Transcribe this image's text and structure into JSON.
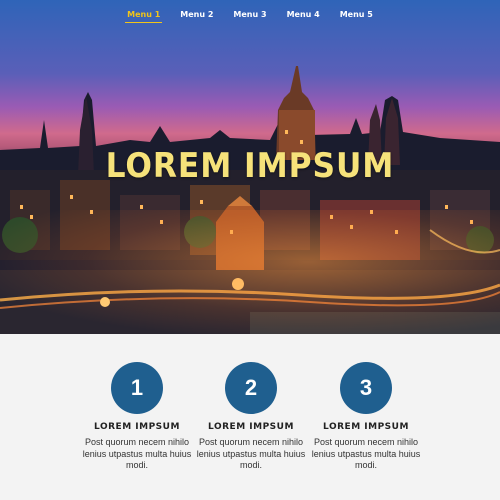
{
  "nav": {
    "items": [
      {
        "label": "Menu 1",
        "active": true
      },
      {
        "label": "Menu 2",
        "active": false
      },
      {
        "label": "Menu 3",
        "active": false
      },
      {
        "label": "Menu 4",
        "active": false
      },
      {
        "label": "Menu 5",
        "active": false
      }
    ]
  },
  "hero": {
    "title": "LOREM IMPSUM"
  },
  "features": [
    {
      "number": "1",
      "title": "LOREM IMPSUM",
      "text": "Post quorum necem nihilo lenius utpastus multa huius modi."
    },
    {
      "number": "2",
      "title": "LOREM IMPSUM",
      "text": "Post quorum necem nihilo lenius utpastus multa huius modi."
    },
    {
      "number": "3",
      "title": "LOREM IMPSUM",
      "text": "Post quorum necem nihilo lenius utpastus multa huius modi."
    }
  ],
  "colors": {
    "accent": "#f0c51a",
    "circle": "#1f5f8f",
    "hero_title": "#f6e27a",
    "background": "#f3f3f3"
  }
}
